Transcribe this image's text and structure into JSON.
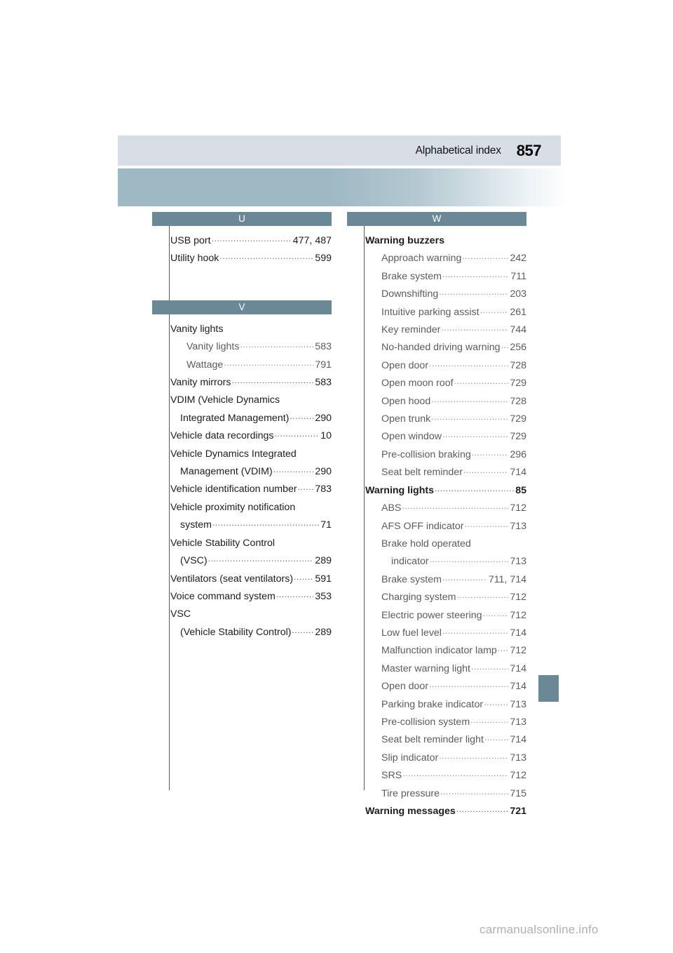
{
  "header": {
    "title": "Alphabetical index",
    "page_number": "857"
  },
  "colors": {
    "header_background": "#d7dee5",
    "band_accent": "#9fb9c4",
    "letter_bar": "#6b8897",
    "side_tab": "#6b8897",
    "entry_text": "#1c1c1c",
    "subentry_text": "#5c5c5c"
  },
  "columns": {
    "left": {
      "sections": [
        {
          "letter": "U",
          "entries": [
            {
              "label": "USB port",
              "page": "477, 487",
              "level": 0,
              "leader": true
            },
            {
              "label": "Utility hook",
              "page": "599",
              "level": 0,
              "leader": true
            }
          ]
        },
        {
          "letter": "V",
          "entries": [
            {
              "label": "Vanity lights",
              "page": "",
              "level": 0,
              "leader": false
            },
            {
              "label": "Vanity lights",
              "page": "583",
              "level": 1,
              "leader": true
            },
            {
              "label": "Wattage",
              "page": "791",
              "level": 1,
              "leader": true
            },
            {
              "label": "Vanity mirrors",
              "page": "583",
              "level": 0,
              "leader": true
            },
            {
              "label": "VDIM (Vehicle Dynamics",
              "page": "",
              "level": 0,
              "leader": false
            },
            {
              "label": "Integrated Management)",
              "page": "290",
              "level": 0,
              "leader": true,
              "cont": true
            },
            {
              "label": "Vehicle data recordings",
              "page": "10",
              "level": 0,
              "leader": true
            },
            {
              "label": "Vehicle Dynamics Integrated",
              "page": "",
              "level": 0,
              "leader": false
            },
            {
              "label": "Management (VDIM)",
              "page": "290",
              "level": 0,
              "leader": true,
              "cont": true
            },
            {
              "label": "Vehicle identification number",
              "page": "783",
              "level": 0,
              "leader": true
            },
            {
              "label": "Vehicle proximity notification",
              "page": "",
              "level": 0,
              "leader": false
            },
            {
              "label": "system",
              "page": "71",
              "level": 0,
              "leader": true,
              "cont": true
            },
            {
              "label": "Vehicle Stability Control",
              "page": "",
              "level": 0,
              "leader": false
            },
            {
              "label": "(VSC)",
              "page": "289",
              "level": 0,
              "leader": true,
              "cont": true
            },
            {
              "label": "Ventilators (seat ventilators)",
              "page": "591",
              "level": 0,
              "leader": true
            },
            {
              "label": "Voice command system",
              "page": "353",
              "level": 0,
              "leader": true
            },
            {
              "label": "VSC",
              "page": "",
              "level": 0,
              "leader": false
            },
            {
              "label": "(Vehicle Stability Control)",
              "page": "289",
              "level": 0,
              "leader": true,
              "cont": true
            }
          ]
        }
      ]
    },
    "right": {
      "sections": [
        {
          "letter": "W",
          "entries": [
            {
              "label": "Warning buzzers",
              "page": "",
              "level": 0,
              "leader": false,
              "bold": true
            },
            {
              "label": "Approach warning",
              "page": "242",
              "level": 1,
              "leader": true
            },
            {
              "label": "Brake system",
              "page": "711",
              "level": 1,
              "leader": true
            },
            {
              "label": "Downshifting",
              "page": "203",
              "level": 1,
              "leader": true
            },
            {
              "label": "Intuitive parking assist",
              "page": "261",
              "level": 1,
              "leader": true
            },
            {
              "label": "Key reminder",
              "page": "744",
              "level": 1,
              "leader": true
            },
            {
              "label": "No-handed driving warning",
              "page": "256",
              "level": 1,
              "leader": true
            },
            {
              "label": "Open door",
              "page": "728",
              "level": 1,
              "leader": true
            },
            {
              "label": "Open moon roof",
              "page": "729",
              "level": 1,
              "leader": true
            },
            {
              "label": "Open hood",
              "page": "728",
              "level": 1,
              "leader": true
            },
            {
              "label": "Open trunk",
              "page": "729",
              "level": 1,
              "leader": true
            },
            {
              "label": "Open window",
              "page": "729",
              "level": 1,
              "leader": true
            },
            {
              "label": "Pre-collision braking",
              "page": "296",
              "level": 1,
              "leader": true
            },
            {
              "label": "Seat belt reminder",
              "page": "714",
              "level": 1,
              "leader": true
            },
            {
              "label": "Warning lights",
              "page": "85",
              "level": 0,
              "leader": true,
              "bold": true
            },
            {
              "label": "ABS",
              "page": "712",
              "level": 1,
              "leader": true
            },
            {
              "label": "AFS OFF indicator",
              "page": "713",
              "level": 1,
              "leader": true
            },
            {
              "label": "Brake hold operated",
              "page": "",
              "level": 1,
              "leader": false
            },
            {
              "label": "indicator",
              "page": "713",
              "level": 1,
              "leader": true,
              "cont": true
            },
            {
              "label": "Brake system",
              "page": "711, 714",
              "level": 1,
              "leader": true
            },
            {
              "label": "Charging system",
              "page": "712",
              "level": 1,
              "leader": true
            },
            {
              "label": "Electric power steering",
              "page": "712",
              "level": 1,
              "leader": true
            },
            {
              "label": "Low fuel level",
              "page": "714",
              "level": 1,
              "leader": true
            },
            {
              "label": "Malfunction indicator lamp",
              "page": "712",
              "level": 1,
              "leader": true
            },
            {
              "label": "Master warning light",
              "page": "714",
              "level": 1,
              "leader": true
            },
            {
              "label": "Open door",
              "page": "714",
              "level": 1,
              "leader": true
            },
            {
              "label": "Parking brake indicator",
              "page": "713",
              "level": 1,
              "leader": true
            },
            {
              "label": "Pre-collision system",
              "page": "713",
              "level": 1,
              "leader": true
            },
            {
              "label": "Seat belt reminder light",
              "page": "714",
              "level": 1,
              "leader": true
            },
            {
              "label": "Slip indicator",
              "page": "713",
              "level": 1,
              "leader": true
            },
            {
              "label": "SRS",
              "page": "712",
              "level": 1,
              "leader": true
            },
            {
              "label": "Tire pressure",
              "page": "715",
              "level": 1,
              "leader": true
            },
            {
              "label": "Warning messages",
              "page": "721",
              "level": 0,
              "leader": true,
              "bold": true
            }
          ]
        }
      ]
    }
  },
  "watermark": {
    "text": "carmanualsonline.info"
  }
}
